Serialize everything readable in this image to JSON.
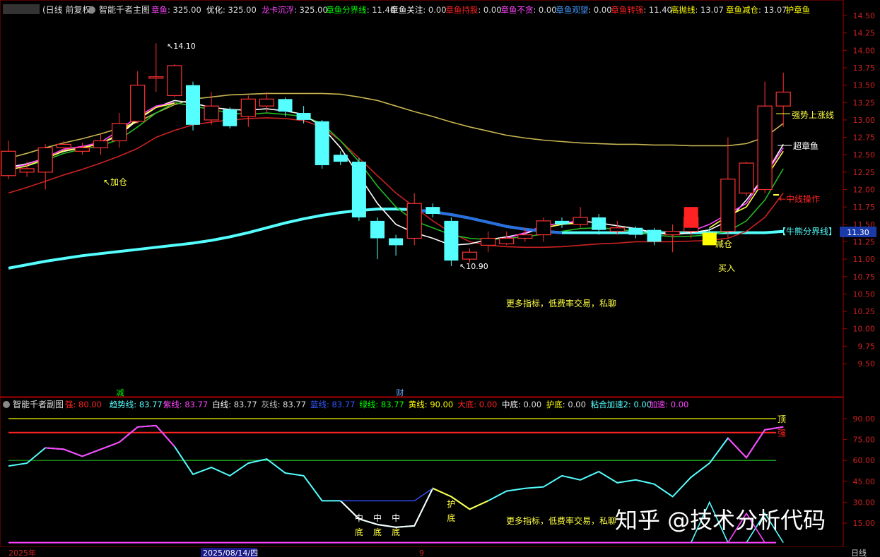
{
  "main_header": {
    "title": "(日线 前复权)",
    "indicator_name": "智能千者主图",
    "pairs": [
      {
        "label": "章鱼",
        "value": "325.00",
        "color": "#ff44ff"
      },
      {
        "label": "优化",
        "value": "325.00",
        "color": "#ffffff"
      },
      {
        "label": "龙卡沉浮",
        "value": "325.00",
        "color": "#ff44ff"
      },
      {
        "label": "章鱼分界线",
        "value": "11.40",
        "color": "#00ff00"
      },
      {
        "label": "章鱼关注",
        "value": "0.00",
        "color": "#ffffff"
      },
      {
        "label": "章鱼持股",
        "value": "0.00",
        "color": "#ff2222"
      },
      {
        "label": "章鱼不贪",
        "value": "0.00",
        "color": "#ff44ff"
      },
      {
        "label": "章鱼观望",
        "value": "0.00",
        "color": "#4499ff"
      },
      {
        "label": "章鱼转强",
        "value": "11.40",
        "color": "#ff2222"
      },
      {
        "label": "高抛线",
        "value": "13.07",
        "color": "#ffff00"
      },
      {
        "label": "章鱼减仓",
        "value": "13.07",
        "color": "#ffff00"
      },
      {
        "label": "护章鱼",
        "value": "",
        "color": "#ffff00"
      }
    ]
  },
  "sub_header": {
    "indicator_name": "智能千者副图",
    "pairs": [
      {
        "label": "强",
        "value": "80.00",
        "color": "#ff2222"
      },
      {
        "label": "趋势线",
        "value": "83.77",
        "color": "#55ffff"
      },
      {
        "label": "紫线",
        "value": "83.77",
        "color": "#ff44ff"
      },
      {
        "label": "白线",
        "value": "83.77",
        "color": "#ffffff"
      },
      {
        "label": "灰线",
        "value": "83.77",
        "color": "#bbbbbb"
      },
      {
        "label": "蓝线",
        "value": "83.77",
        "color": "#3355ff"
      },
      {
        "label": "绿线",
        "value": "83.77",
        "color": "#00ff00"
      },
      {
        "label": "黄线",
        "value": "90.00",
        "color": "#ffff00"
      },
      {
        "label": "大底",
        "value": "0.00",
        "color": "#ff2222"
      },
      {
        "label": "中底",
        "value": "0.00",
        "color": "#ffffff"
      },
      {
        "label": "护底",
        "value": "0.00",
        "color": "#ffff00"
      },
      {
        "label": "粘合加速2",
        "value": "0.00",
        "color": "#55ffff"
      },
      {
        "label": "加速",
        "value": "0.00",
        "color": "#ff44ff"
      }
    ]
  },
  "footer": {
    "year_label": "2025年",
    "date_label": "2025/08/14/四",
    "small_label": "9",
    "period_label": "日线"
  },
  "watermark": "知乎 @技术分析代码",
  "chart_data": [
    {
      "type": "candlestick",
      "title": "智能千者主图",
      "ylim": [
        9.0,
        14.6
      ],
      "y_ticks": [
        "14.50",
        "14.25",
        "14.00",
        "13.75",
        "13.50",
        "13.25",
        "13.00",
        "12.75",
        "12.50",
        "12.25",
        "12.00",
        "11.75",
        "11.50",
        "11.25",
        "11.00",
        "10.75",
        "10.50",
        "10.25",
        "10.00",
        "9.75",
        "9.50"
      ],
      "candles": [
        {
          "o": 12.2,
          "c": 12.55,
          "h": 12.7,
          "l": 12.15
        },
        {
          "o": 12.25,
          "c": 12.3,
          "h": 12.4,
          "l": 12.18
        },
        {
          "o": 12.25,
          "c": 12.6,
          "h": 12.65,
          "l": 12.0
        },
        {
          "o": 12.6,
          "c": 12.65,
          "h": 12.7,
          "l": 12.55
        },
        {
          "o": 12.55,
          "c": 12.6,
          "h": 12.67,
          "l": 12.5
        },
        {
          "o": 12.6,
          "c": 12.7,
          "h": 12.8,
          "l": 12.5
        },
        {
          "o": 12.7,
          "c": 12.95,
          "h": 13.1,
          "l": 12.6
        },
        {
          "o": 12.98,
          "c": 13.5,
          "h": 13.7,
          "l": 12.95
        },
        {
          "o": 13.6,
          "c": 13.62,
          "h": 14.1,
          "l": 13.4
        },
        {
          "o": 13.35,
          "c": 13.78,
          "h": 13.8,
          "l": 13.33
        },
        {
          "o": 13.5,
          "c": 12.93,
          "h": 13.55,
          "l": 12.85
        },
        {
          "o": 13.0,
          "c": 13.2,
          "h": 13.4,
          "l": 12.93
        },
        {
          "o": 13.15,
          "c": 12.91,
          "h": 13.18,
          "l": 12.88
        },
        {
          "o": 13.05,
          "c": 13.3,
          "h": 13.35,
          "l": 12.9
        },
        {
          "o": 13.2,
          "c": 13.3,
          "h": 13.4,
          "l": 13.1
        },
        {
          "o": 13.3,
          "c": 13.12,
          "h": 13.32,
          "l": 13.05
        },
        {
          "o": 13.1,
          "c": 13.0,
          "h": 13.2,
          "l": 12.95
        },
        {
          "o": 12.98,
          "c": 12.35,
          "h": 13.0,
          "l": 12.3
        },
        {
          "o": 12.5,
          "c": 12.4,
          "h": 12.55,
          "l": 12.35
        },
        {
          "o": 12.4,
          "c": 11.6,
          "h": 12.45,
          "l": 11.55
        },
        {
          "o": 11.55,
          "c": 11.3,
          "h": 11.6,
          "l": 11.0
        },
        {
          "o": 11.3,
          "c": 11.2,
          "h": 11.35,
          "l": 11.05
        },
        {
          "o": 11.3,
          "c": 11.8,
          "h": 11.95,
          "l": 11.2
        },
        {
          "o": 11.75,
          "c": 11.65,
          "h": 11.8,
          "l": 11.6
        },
        {
          "o": 11.55,
          "c": 10.98,
          "h": 11.6,
          "l": 10.9
        },
        {
          "o": 11.0,
          "c": 11.1,
          "h": 11.15,
          "l": 10.95
        },
        {
          "o": 11.2,
          "c": 11.3,
          "h": 11.4,
          "l": 11.1
        },
        {
          "o": 11.22,
          "c": 11.3,
          "h": 11.4,
          "l": 11.2
        },
        {
          "o": 11.3,
          "c": 11.35,
          "h": 11.45,
          "l": 11.25
        },
        {
          "o": 11.35,
          "c": 11.55,
          "h": 11.6,
          "l": 11.25
        },
        {
          "o": 11.55,
          "c": 11.5,
          "h": 11.6,
          "l": 11.45
        },
        {
          "o": 11.5,
          "c": 11.6,
          "h": 11.75,
          "l": 11.45
        },
        {
          "o": 11.6,
          "c": 11.42,
          "h": 11.65,
          "l": 11.35
        },
        {
          "o": 11.4,
          "c": 11.45,
          "h": 11.55,
          "l": 11.35
        },
        {
          "o": 11.45,
          "c": 11.35,
          "h": 11.47,
          "l": 11.3
        },
        {
          "o": 11.42,
          "c": 11.25,
          "h": 11.45,
          "l": 11.2
        },
        {
          "o": 11.35,
          "c": 11.4,
          "h": 11.5,
          "l": 11.1
        },
        {
          "o": 11.4,
          "c": 11.6,
          "h": 11.7,
          "l": 11.3
        },
        {
          "o": 11.4,
          "c": 11.35,
          "h": 11.45,
          "l": 11.25
        },
        {
          "o": 11.4,
          "c": 12.15,
          "h": 12.75,
          "l": 11.3
        },
        {
          "o": 11.95,
          "c": 12.38,
          "h": 12.4,
          "l": 11.9
        },
        {
          "o": 12.0,
          "c": 13.2,
          "h": 13.55,
          "l": 11.95
        },
        {
          "o": 13.2,
          "c": 13.4,
          "h": 13.68,
          "l": 12.9
        }
      ],
      "lines": [
        {
          "name": "牛熊分界线",
          "color": "#55ffff",
          "values": [
            10.87,
            10.92,
            10.97,
            11.01,
            11.05,
            11.08,
            11.11,
            11.14,
            11.17,
            11.2,
            11.23,
            11.27,
            11.32,
            11.38,
            11.45,
            11.52,
            11.58,
            11.63,
            11.67,
            11.7,
            11.72,
            11.72,
            11.71,
            11.68,
            11.64,
            11.59,
            11.53,
            11.47,
            11.43,
            11.4,
            11.38,
            11.38,
            11.38,
            11.38,
            11.38,
            11.38,
            11.38,
            11.38,
            11.38,
            11.38,
            11.38,
            11.38,
            11.4
          ]
        },
        {
          "name": "上轨",
          "color": "#c8b450",
          "values": [
            12.45,
            12.52,
            12.6,
            12.67,
            12.73,
            12.8,
            12.88,
            12.97,
            13.1,
            13.22,
            13.3,
            13.33,
            13.36,
            13.37,
            13.38,
            13.38,
            13.38,
            13.38,
            13.37,
            13.33,
            13.28,
            13.2,
            13.12,
            13.05,
            12.97,
            12.9,
            12.84,
            12.78,
            12.74,
            12.71,
            12.69,
            12.67,
            12.66,
            12.65,
            12.65,
            12.64,
            12.64,
            12.63,
            12.63,
            12.63,
            12.66,
            12.75,
            12.95
          ]
        },
        {
          "name": "下轨",
          "color": "#cc2222",
          "values": [
            11.95,
            12.03,
            12.12,
            12.21,
            12.29,
            12.38,
            12.48,
            12.59,
            12.75,
            12.85,
            12.93,
            12.97,
            13.0,
            13.02,
            13.03,
            13.02,
            12.99,
            12.9,
            12.7,
            12.45,
            12.2,
            11.95,
            11.75,
            11.55,
            11.38,
            11.25,
            11.2,
            11.18,
            11.17,
            11.17,
            11.18,
            11.2,
            11.22,
            11.23,
            11.25,
            11.25,
            11.25,
            11.26,
            11.27,
            11.3,
            11.4,
            11.6,
            11.95
          ]
        },
        {
          "name": "绿线",
          "color": "#22bb22",
          "values": [
            12.28,
            12.34,
            12.42,
            12.52,
            12.58,
            12.63,
            12.72,
            12.9,
            13.1,
            13.25,
            13.2,
            13.15,
            13.1,
            13.08,
            13.1,
            13.08,
            13.05,
            12.95,
            12.7,
            12.4,
            12.05,
            11.75,
            11.55,
            11.45,
            11.35,
            11.3,
            11.28,
            11.3,
            11.32,
            11.36,
            11.4,
            11.44,
            11.45,
            11.43,
            11.4,
            11.35,
            11.32,
            11.33,
            11.35,
            11.4,
            11.55,
            11.85,
            12.3
          ]
        },
        {
          "name": "白线",
          "color": "#ffffff",
          "values": [
            12.32,
            12.37,
            12.45,
            12.55,
            12.6,
            12.66,
            12.78,
            13.0,
            13.18,
            13.28,
            13.24,
            13.18,
            13.15,
            13.14,
            13.16,
            13.13,
            13.08,
            12.9,
            12.6,
            12.2,
            11.8,
            11.5,
            11.38,
            11.3,
            11.2,
            11.22,
            11.28,
            11.32,
            11.37,
            11.45,
            11.5,
            11.55,
            11.52,
            11.48,
            11.44,
            11.38,
            11.35,
            11.38,
            11.42,
            11.55,
            11.85,
            12.2,
            12.65
          ]
        },
        {
          "name": "紫线",
          "color": "#ff44ff",
          "values": [
            12.3,
            12.36,
            12.46,
            12.58,
            12.62,
            12.68,
            12.85,
            13.05,
            13.2,
            13.25,
            null,
            null,
            null,
            null,
            null,
            null,
            null,
            null,
            null,
            null,
            null,
            null,
            null,
            null,
            null,
            null,
            null,
            11.3,
            11.38,
            11.48,
            11.52,
            11.55,
            null,
            null,
            null,
            null,
            null,
            11.4,
            11.5,
            11.65,
            11.8,
            12.2,
            12.6
          ]
        },
        {
          "name": "黄线",
          "color": "#ffff44",
          "values": [
            12.28,
            12.34,
            12.44,
            12.56,
            12.6,
            12.66,
            12.8,
            13.02,
            13.18,
            13.24,
            null,
            null,
            null,
            null,
            null,
            null,
            null,
            null,
            null,
            null,
            null,
            null,
            null,
            null,
            null,
            null,
            null,
            null,
            null,
            11.45,
            11.5,
            11.52,
            null,
            null,
            null,
            null,
            null,
            null,
            11.45,
            11.62,
            11.75,
            12.15,
            12.55
          ]
        }
      ],
      "annotations": [
        {
          "text": "14.10",
          "kind": "high"
        },
        {
          "text": "10.90",
          "kind": "low"
        },
        {
          "text": "加仓",
          "color": "#ffff44"
        },
        {
          "text": "减仓",
          "color": "#ffff44"
        },
        {
          "text": "买入",
          "color": "#ffff44"
        },
        {
          "text": "强势上涨线",
          "color": "#ffff44"
        },
        {
          "text": "超章鱼",
          "color": "#ffffff"
        },
        {
          "text": "中线操作",
          "color": "#ff2222"
        },
        {
          "text": "【牛熊分界线】",
          "color": "#55ffff"
        },
        {
          "text": "更多指标，低费率交易，私聊",
          "color": "#ffff44"
        }
      ],
      "price_tag": "11.30",
      "markers": [
        {
          "text": "减",
          "color": "#00ff00"
        },
        {
          "text": "财",
          "color": "#66aaff"
        }
      ]
    },
    {
      "type": "line",
      "title": "智能千者副图",
      "ylim": [
        0,
        100
      ],
      "y_ticks": [
        "90.00",
        "75.00",
        "60.00",
        "45.00",
        "30.00",
        "15.00"
      ],
      "reference_lines": [
        {
          "name": "黄线",
          "value": 90,
          "color": "#cccc00",
          "label": "顶"
        },
        {
          "name": "强",
          "value": 80,
          "color": "#ff2222",
          "label": "强"
        },
        {
          "name": "绿线",
          "value": 60,
          "color": "#22aa22"
        }
      ],
      "series": [
        {
          "name": "趋势线",
          "color": "#55ffff",
          "values": [
            56,
            58,
            69,
            68,
            63,
            68,
            73,
            84,
            85,
            70,
            50,
            55,
            49,
            58,
            61,
            51,
            49,
            31,
            31,
            18,
            14,
            12,
            13,
            40,
            34,
            25,
            31,
            38,
            40,
            41,
            49,
            46,
            52,
            44,
            46,
            43,
            34,
            48,
            58,
            76,
            62,
            82,
            84
          ]
        },
        {
          "name": "紫线",
          "color": "#ff44ff"
        },
        {
          "name": "白线",
          "color": "#ffffff"
        },
        {
          "name": "黄线",
          "color": "#ffff44"
        }
      ],
      "labels": [
        {
          "text": "中底",
          "color": "#ffff44"
        },
        {
          "text": "护底",
          "color": "#ffff44"
        },
        {
          "text": "更多指标，低费率交易，私聊",
          "color": "#ffff44"
        }
      ]
    }
  ]
}
